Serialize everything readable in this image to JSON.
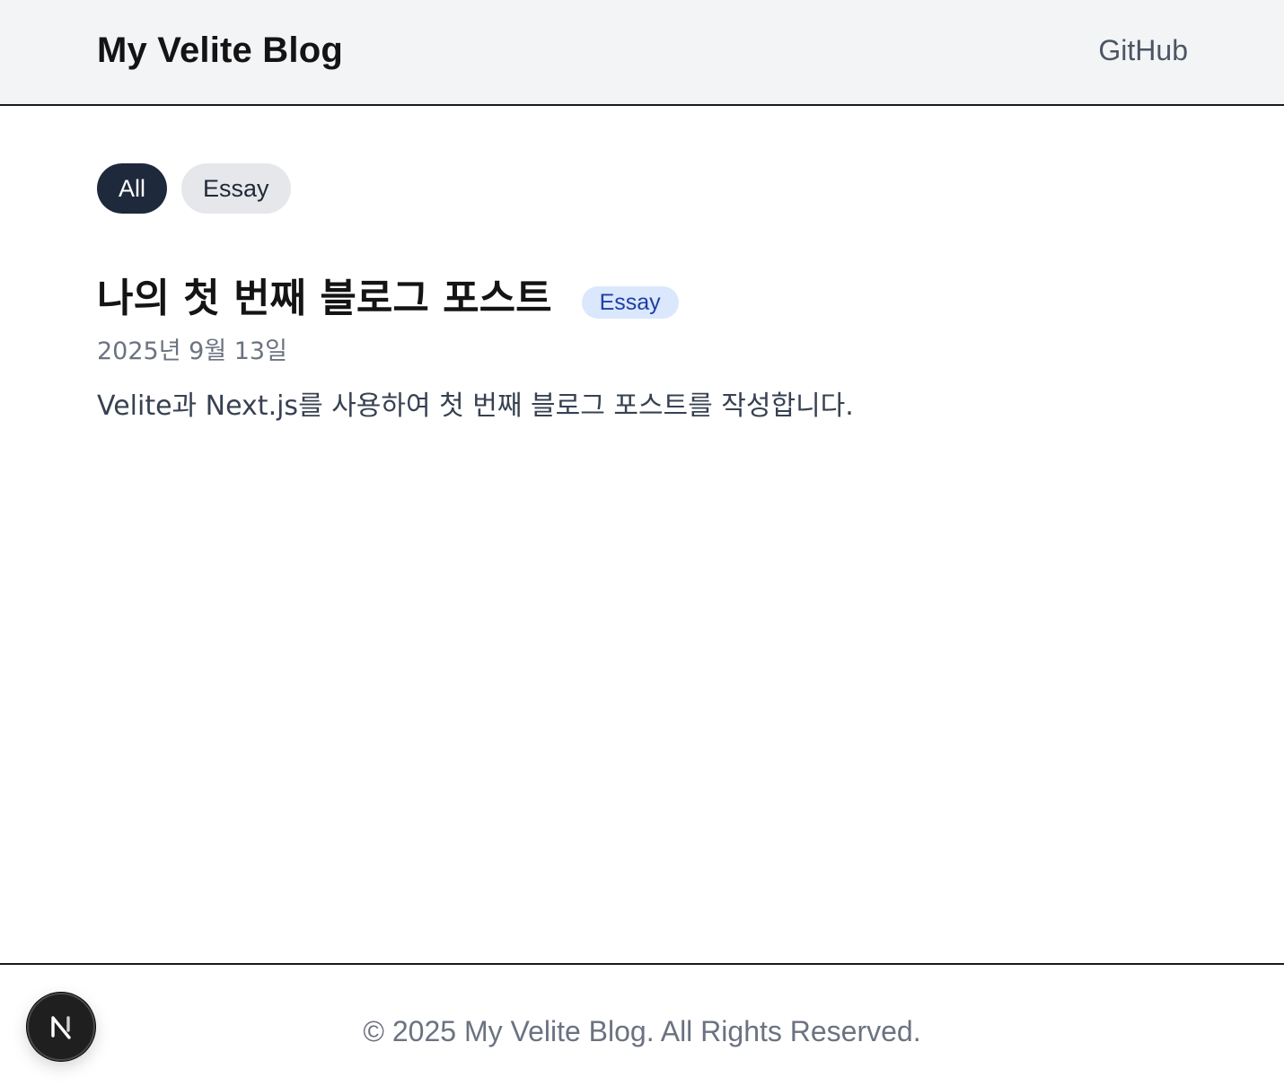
{
  "header": {
    "site_title": "My Velite Blog",
    "github_label": "GitHub"
  },
  "filters": [
    {
      "label": "All",
      "active": true
    },
    {
      "label": "Essay",
      "active": false
    }
  ],
  "posts": [
    {
      "title": "나의 첫 번째 블로그 포스트",
      "tag": "Essay",
      "date": "2025년 9월 13일",
      "summary": "Velite과 Next.js를 사용하여 첫 번째 블로그 포스트를 작성합니다."
    }
  ],
  "footer": {
    "copyright": "© 2025 My Velite Blog. All Rights Reserved."
  },
  "dev_indicator": {
    "icon": "nextjs-logo-icon",
    "letter": "N"
  },
  "colors": {
    "header_bg": "#f3f4f6",
    "active_pill_bg": "#1e293b",
    "inactive_pill_bg": "#e5e7eb",
    "tag_bg": "#dbe7fc",
    "tag_text": "#1e3fa8",
    "muted_text": "#6b7280"
  }
}
